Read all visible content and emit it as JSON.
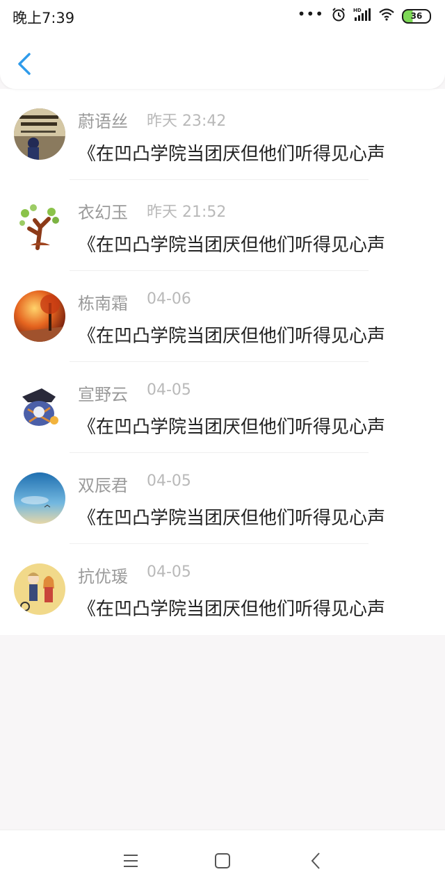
{
  "status_bar": {
    "time": "晚上7:39",
    "battery": "36",
    "icons": [
      "more-dots-icon",
      "alarm-icon",
      "hd-signal-icon",
      "wifi-icon",
      "battery-icon"
    ]
  },
  "header": {
    "back_icon": "chevron-left-icon",
    "accent_color": "#2f9bea"
  },
  "messages": [
    {
      "name": "蔚语丝",
      "time": "昨天 23:42",
      "text": "《在凹凸学院当团厌但他们听得见心声"
    },
    {
      "name": "衣幻玉",
      "time": "昨天 21:52",
      "text": "《在凹凸学院当团厌但他们听得见心声"
    },
    {
      "name": "栋南霜",
      "time": "04-06",
      "text": "《在凹凸学院当团厌但他们听得见心声"
    },
    {
      "name": "宣野云",
      "time": "04-05",
      "text": "《在凹凸学院当团厌但他们听得见心声"
    },
    {
      "name": "双辰君",
      "time": "04-05",
      "text": "《在凹凸学院当团厌但他们听得见心声"
    },
    {
      "name": "抗优瑗",
      "time": "04-05",
      "text": "《在凹凸学院当团厌但他们听得见心声"
    }
  ],
  "nav_bar": {
    "icons": [
      "menu-icon",
      "home-square-icon",
      "back-triangle-icon"
    ]
  }
}
